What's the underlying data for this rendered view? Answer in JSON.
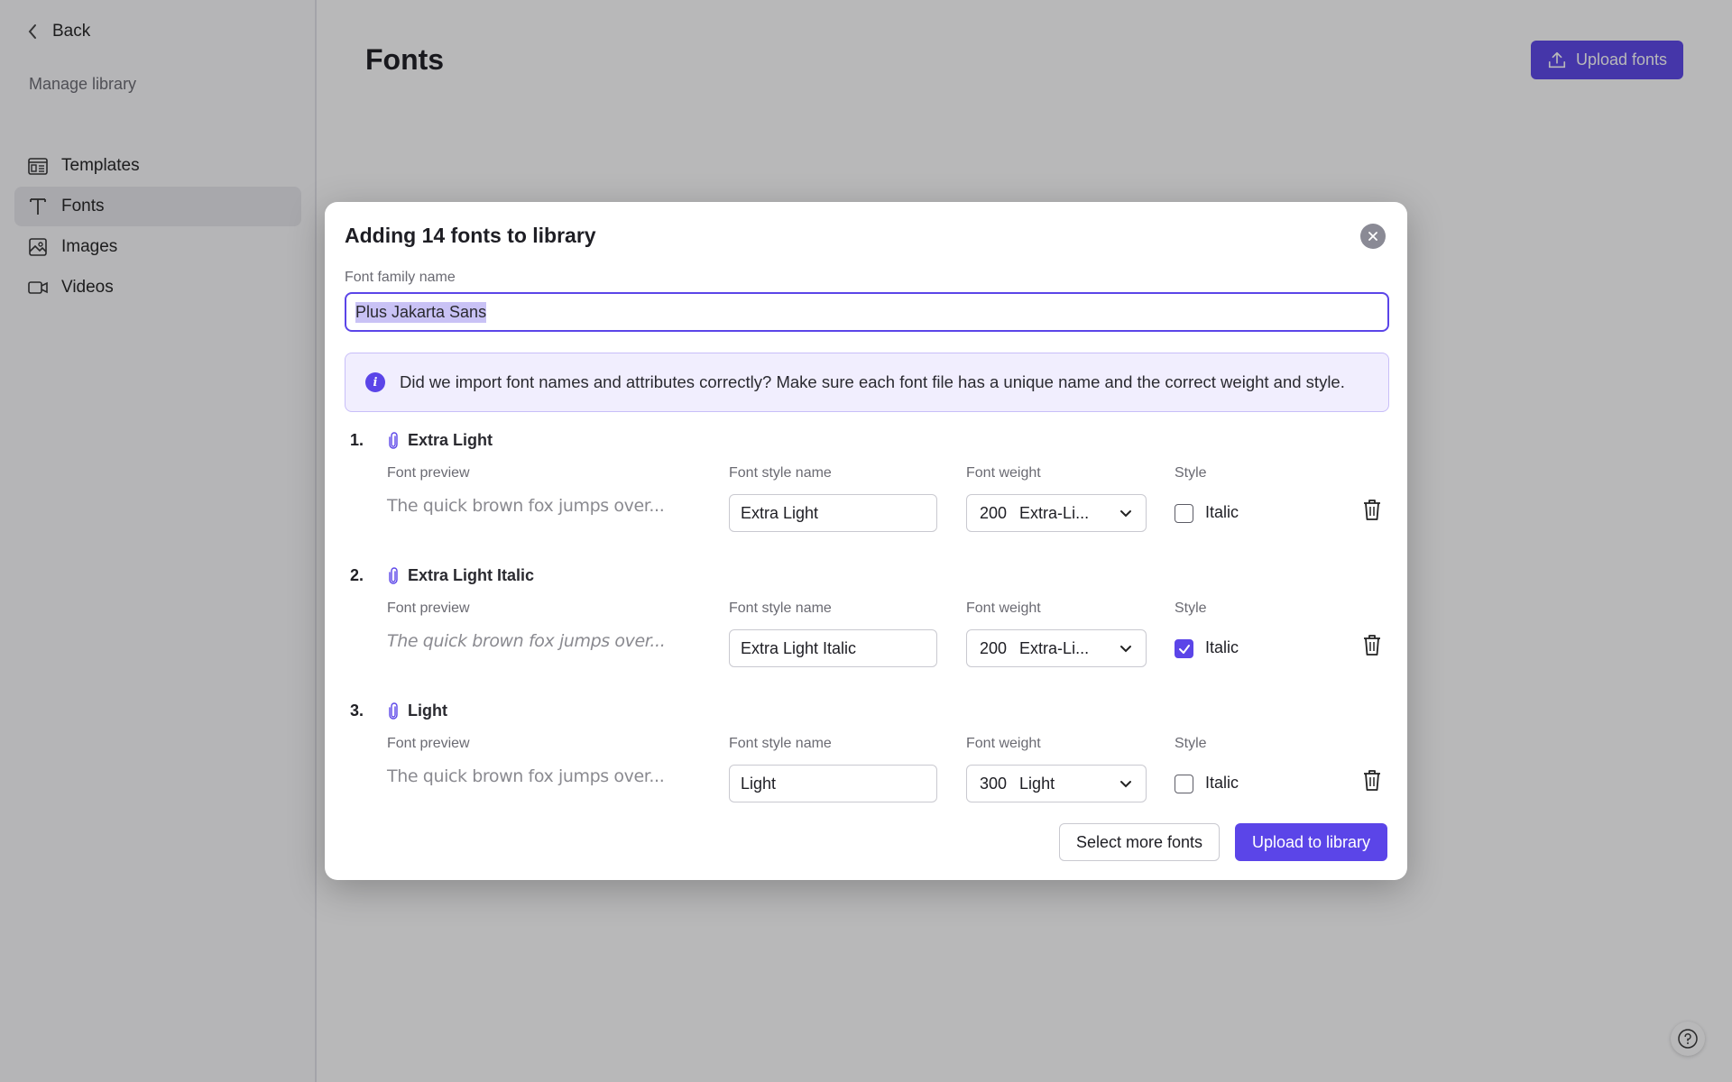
{
  "sidebar": {
    "back_label": "Back",
    "section_label": "Manage library",
    "items": [
      {
        "label": "Templates"
      },
      {
        "label": "Fonts"
      },
      {
        "label": "Images"
      },
      {
        "label": "Videos"
      }
    ],
    "active_item": "Fonts"
  },
  "main": {
    "title": "Fonts",
    "upload_button": "Upload fonts"
  },
  "modal": {
    "title": "Adding 14 fonts to library",
    "family_label": "Font family name",
    "family_value": "Plus Jakarta Sans",
    "info_text": "Did we import font names and attributes correctly? Make sure each font file has a unique name and the correct weight and style.",
    "info_icon": "i",
    "field_labels": {
      "preview": "Font preview",
      "style_name": "Font style name",
      "weight": "Font weight",
      "style": "Style",
      "italic": "Italic"
    },
    "fonts": [
      {
        "number": "1.",
        "name": "Extra Light",
        "preview": "The quick brown fox jumps over...",
        "style_name": "Extra Light",
        "weight_num": "200",
        "weight_name": "Extra-Li...",
        "italic": false
      },
      {
        "number": "2.",
        "name": "Extra Light Italic",
        "preview": "The quick brown fox jumps over...",
        "style_name": "Extra Light Italic",
        "weight_num": "200",
        "weight_name": "Extra-Li...",
        "italic": true
      },
      {
        "number": "3.",
        "name": "Light",
        "preview": "The quick brown fox jumps over...",
        "style_name": "Light",
        "weight_num": "300",
        "weight_name": "Light",
        "italic": false
      }
    ],
    "select_more_button": "Select more fonts",
    "upload_button": "Upload to library"
  },
  "colors": {
    "accent": "#5b45e8",
    "info_bg": "#f1eefe"
  }
}
